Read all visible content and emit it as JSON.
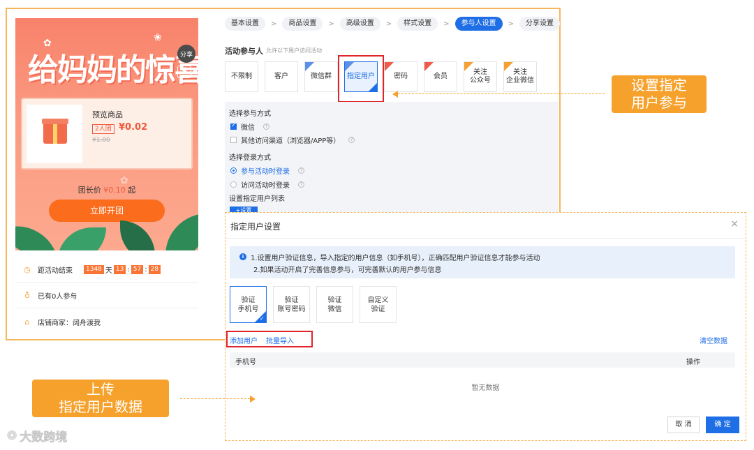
{
  "preview": {
    "poster_title": "给妈妈的惊喜",
    "share_label": "分享",
    "menu_symbol": "☰",
    "product": {
      "name": "预览商品",
      "group_tag": "2人团",
      "price": "¥0.02",
      "original_price": "¥1.00"
    },
    "leader_price_prefix": "团长价",
    "leader_price_value": "¥0.10",
    "leader_price_suffix": "起",
    "start_button": "立即开团",
    "countdown": {
      "label": "距活动结束",
      "days": "1348",
      "day_unit": "天",
      "h": "13",
      "m": "57",
      "s": "28"
    },
    "participants": "已有0人参与",
    "shop": "店铺商家：阔舟渡我"
  },
  "steps": [
    {
      "label": "基本设置",
      "active": false
    },
    {
      "label": "商品设置",
      "active": false
    },
    {
      "label": "高级设置",
      "active": false
    },
    {
      "label": "样式设置",
      "active": false
    },
    {
      "label": "参与人设置",
      "active": true
    },
    {
      "label": "分享设置",
      "active": false
    }
  ],
  "step_arrow": ">",
  "participants_section": {
    "title": "活动参与人",
    "subtitle": "允许以下用户访问活动",
    "options": [
      {
        "label": "不限制",
        "corner": ""
      },
      {
        "label": "客户",
        "corner": ""
      },
      {
        "label": "微信群",
        "corner": "blue"
      },
      {
        "label": "指定用户",
        "corner": "blue",
        "selected": true
      },
      {
        "label": "密码",
        "corner": "red"
      },
      {
        "label": "会员",
        "corner": "red"
      },
      {
        "label": "关注\n公众号",
        "corner": "orange"
      },
      {
        "label": "关注\n企业微信",
        "corner": "orange"
      }
    ]
  },
  "settings": {
    "method_title": "选择参与方式",
    "wechat": "微信",
    "other_channel": "其他访问渠道（浏览器/APP等）",
    "login_title": "选择登录方式",
    "login_on_join": "参与活动时登录",
    "login_on_visit": "访问活动时登录",
    "user_list_title": "设置指定用户列表",
    "setting_button": "+设置",
    "help_icon": "?"
  },
  "dialog": {
    "title": "指定用户设置",
    "close": "×",
    "info_icon": "i",
    "notice_line1": "1.设置用户验证信息，导入指定的用户信息（如手机号），正确匹配用户验证信息才能参与活动",
    "notice_line2": "2.如果活动开启了完善信息参与，可完善默认的用户参与信息",
    "verify_options": [
      {
        "label": "验证\n手机号",
        "selected": true
      },
      {
        "label": "验证\n账号密码",
        "selected": false
      },
      {
        "label": "验证\n微信",
        "selected": false
      },
      {
        "label": "自定义\n验证",
        "selected": false
      }
    ],
    "add_user": "添加用户",
    "batch_import": "批量导入",
    "clear_data": "清空数据",
    "col_phone": "手机号",
    "col_action": "操作",
    "empty": "暂无数据",
    "cancel": "取 消",
    "confirm": "确 定"
  },
  "callouts": {
    "c1_line1": "设置指定",
    "c1_line2": "用户参与",
    "c2_line1": "上传",
    "c2_line2": "指定用户数据"
  },
  "watermark": "大数跨境",
  "colors": {
    "primary": "#1e6ee6",
    "accent": "#f6a12c",
    "highlight": "#e0242b",
    "poster": "#f8826a"
  }
}
